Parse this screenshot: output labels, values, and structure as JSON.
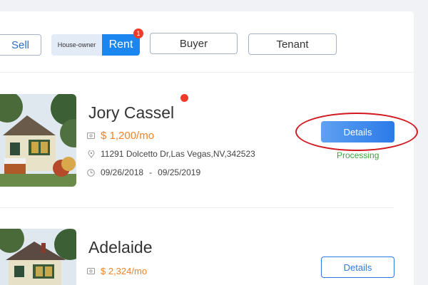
{
  "filters": {
    "sell_label": "Sell",
    "owner_label": "House-owner",
    "rent_label": "Rent",
    "rent_badge": "1",
    "buyer_label": "Buyer",
    "tenant_label": "Tenant"
  },
  "listings": [
    {
      "name": "Jory Cassel",
      "unread": true,
      "price": "$ 1,200/mo",
      "address": "11291 Dolcetto Dr,Las Vegas,NV,342523",
      "date_start": "09/26/2018",
      "date_sep": "-",
      "date_end": "09/25/2019",
      "details_label": "Details",
      "status": "Processing"
    },
    {
      "name": "Adelaide",
      "price": "$ 2,324/mo",
      "details_label": "Details"
    }
  ],
  "colors": {
    "accent": "#1b85f0",
    "price": "#f0832a",
    "status_ok": "#38a83c",
    "badge": "#f03a2a",
    "annotation": "#d0181e"
  },
  "icons": {
    "price": "money-icon",
    "address": "location-pin-icon",
    "date": "clock-icon"
  }
}
